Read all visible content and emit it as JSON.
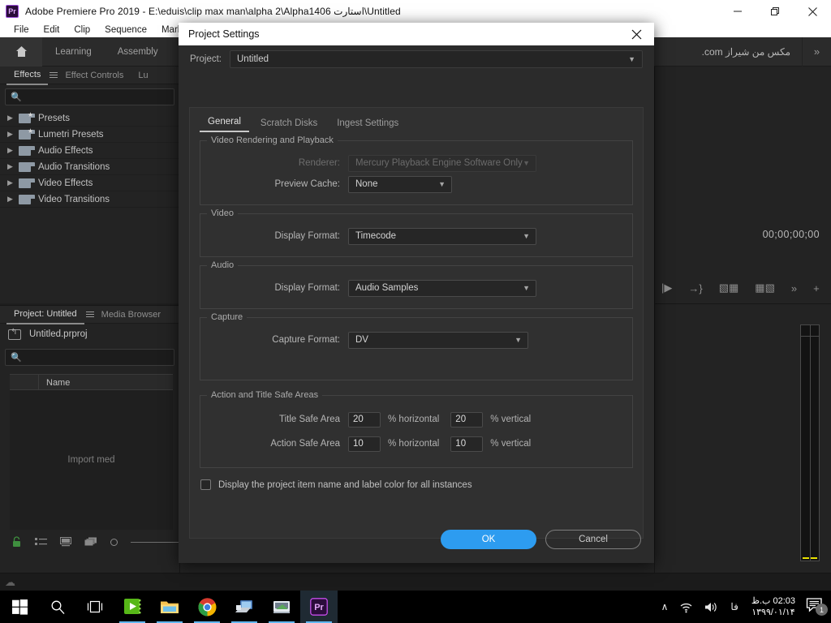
{
  "window": {
    "app_badge": "Pr",
    "title": "Adobe Premiere Pro 2019 - E:\\eduis\\clip max man\\alpha 2\\Alpha1406 استارت\\Untitled",
    "minimize": "minimize-icon",
    "maximize": "restore-icon",
    "close": "close-icon"
  },
  "menubar": {
    "items": [
      {
        "label": "File"
      },
      {
        "label": "Edit"
      },
      {
        "label": "Clip"
      },
      {
        "label": "Sequence"
      },
      {
        "label": "Markers"
      }
    ]
  },
  "workspace": {
    "home_icon": "home-icon",
    "tabs": [
      {
        "label": "Learning"
      },
      {
        "label": "Assembly"
      }
    ],
    "watermark": "مکس من شیراز com.",
    "overflow": "»"
  },
  "effects_panel": {
    "tabs": [
      {
        "label": "Effects",
        "active": true
      },
      {
        "label": "Effect Controls",
        "active": false
      },
      {
        "label": "Lu",
        "active": false
      }
    ],
    "search_placeholder": "",
    "search_value": "",
    "tree": [
      {
        "label": "Presets",
        "icon": "folder-star-icon"
      },
      {
        "label": "Lumetri Presets",
        "icon": "folder-star-icon"
      },
      {
        "label": "Audio Effects",
        "icon": "folder-icon"
      },
      {
        "label": "Audio Transitions",
        "icon": "folder-icon"
      },
      {
        "label": "Video Effects",
        "icon": "folder-icon"
      },
      {
        "label": "Video Transitions",
        "icon": "folder-icon"
      }
    ]
  },
  "project_panel": {
    "tabs": [
      {
        "label": "Project: Untitled",
        "active": true
      },
      {
        "label": "Media Browser",
        "active": false
      }
    ],
    "file_name": "Untitled.prproj",
    "search_value": "",
    "column_header": "Name",
    "empty_hint": "Import med",
    "toolbar_icons": [
      "lock-icon",
      "list-view-icon",
      "icon-view-icon",
      "freeform-view-icon",
      "zoom-slider"
    ]
  },
  "monitor": {
    "timecode": "00;00;00;00",
    "tool_icons": [
      "mark-in-icon",
      "go-to-out-icon",
      "insert-icon",
      "overwrite-icon",
      "more-icon",
      "add-button-icon"
    ]
  },
  "dialog": {
    "title": "Project Settings",
    "close_icon": "close-icon",
    "project_label": "Project:",
    "project_value": "Untitled",
    "tabs": [
      {
        "label": "General",
        "active": true
      },
      {
        "label": "Scratch Disks",
        "active": false
      },
      {
        "label": "Ingest Settings",
        "active": false
      }
    ],
    "groups": [
      {
        "legend": "Video Rendering and Playback",
        "rows": [
          {
            "label": "Renderer:",
            "value": "Mercury Playback Engine Software Only",
            "disabled": true,
            "width": "w230"
          },
          {
            "label": "Preview Cache:",
            "value": "None",
            "disabled": false,
            "width": "w130"
          }
        ]
      },
      {
        "legend": "Video",
        "rows": [
          {
            "label": "Display Format:",
            "value": "Timecode",
            "disabled": false,
            "width": "w230"
          }
        ]
      },
      {
        "legend": "Audio",
        "rows": [
          {
            "label": "Display Format:",
            "value": "Audio Samples",
            "disabled": false,
            "width": "w230"
          }
        ]
      },
      {
        "legend": "Capture",
        "rows": [
          {
            "label": "Capture Format:",
            "value": "DV",
            "disabled": false,
            "width": "w220"
          }
        ]
      }
    ],
    "safe_areas": {
      "legend": "Action and Title Safe Areas",
      "rows": [
        {
          "label": "Title Safe Area",
          "h_value": "20",
          "h_unit": "% horizontal",
          "v_value": "20",
          "v_unit": "% vertical"
        },
        {
          "label": "Action Safe Area",
          "h_value": "10",
          "h_unit": "% horizontal",
          "v_value": "10",
          "v_unit": "% vertical"
        }
      ]
    },
    "checkbox": {
      "label": "Display the project item name and label color for all instances",
      "checked": false
    },
    "buttons": {
      "ok": "OK",
      "cancel": "Cancel",
      "ok_color": "#2d9cf0"
    }
  },
  "taskbar": {
    "items": [
      {
        "name": "start-button",
        "icon": "windows-logo-icon"
      },
      {
        "name": "search-button",
        "icon": "search-icon"
      },
      {
        "name": "task-view-button",
        "icon": "task-view-icon"
      },
      {
        "name": "taskbar-app-media",
        "icon": "green-media-app-icon"
      },
      {
        "name": "taskbar-app-explorer",
        "icon": "file-explorer-icon"
      },
      {
        "name": "taskbar-app-chrome",
        "icon": "chrome-icon"
      },
      {
        "name": "taskbar-app-system1",
        "icon": "computer-icon"
      },
      {
        "name": "taskbar-app-system2",
        "icon": "monitor-icon"
      },
      {
        "name": "taskbar-app-premiere",
        "icon": "premiere-pro-icon"
      }
    ],
    "tray": {
      "chevron": "∧",
      "network": "wifi-icon",
      "volume": "volume-icon",
      "language": "فا",
      "time": "02:03 ب.ظ",
      "date": "۱۳۹۹/۰۱/۱۴",
      "notification_count": "1"
    }
  }
}
